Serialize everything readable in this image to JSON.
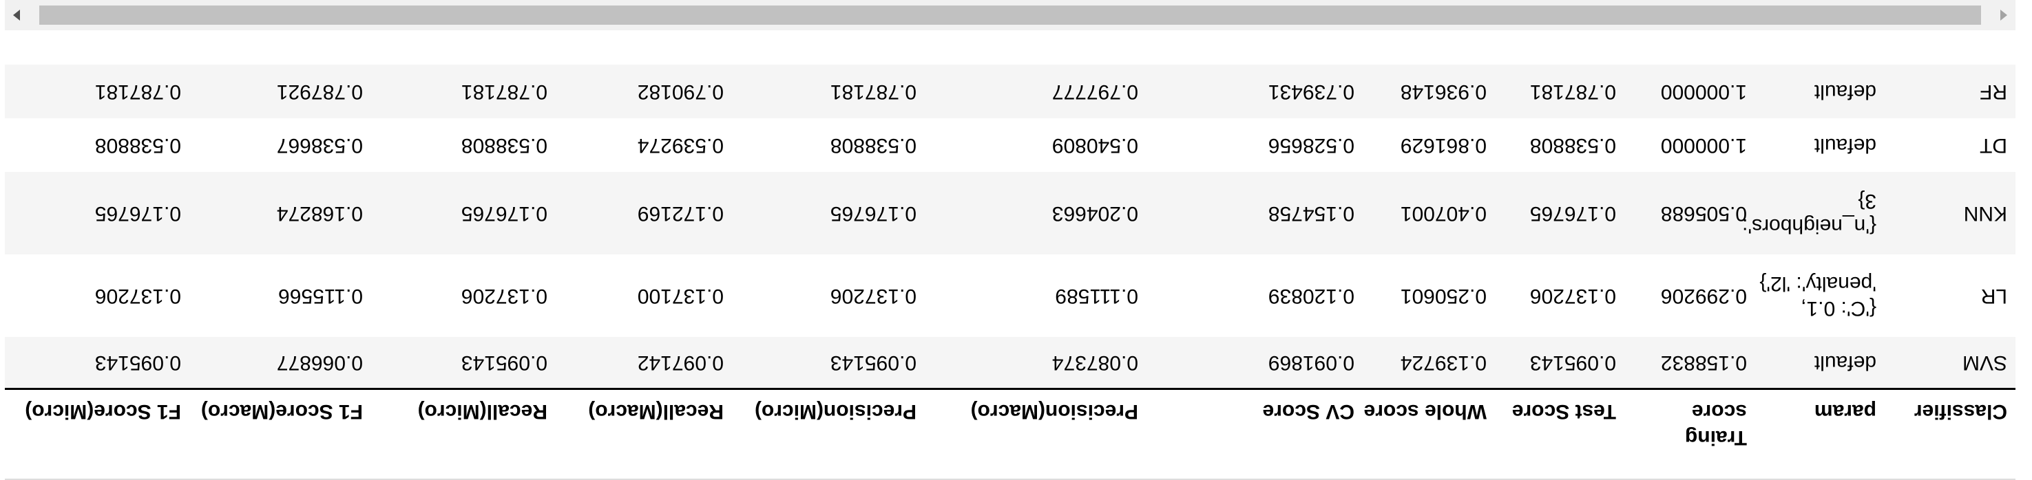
{
  "table": {
    "headers": [
      "Classifier",
      "param",
      "Traing score",
      "Test Score",
      "Whole score",
      "CV Score",
      "Precision(Macro)",
      "Precision(Micro)",
      "Recall(Macro)",
      "Recall(Micro)",
      "F1 Score(Macro)",
      "F1 Score(Micro)"
    ],
    "rows": [
      [
        "SVM",
        "default",
        "0.158832",
        "0.095143",
        "0.139724",
        "0.091869",
        "0.087374",
        "0.095143",
        "0.097142",
        "0.095143",
        "0.066877",
        "0.095143"
      ],
      [
        "LR",
        "{'C': 0.1, 'penalty': 'l2'}",
        "0.299206",
        "0.137206",
        "0.250601",
        "0.120839",
        "0.111589",
        "0.137206",
        "0.137100",
        "0.137206",
        "0.115566",
        "0.137206"
      ],
      [
        "KNN",
        "{'n_neighbors': 3}",
        "0.505688",
        "0.176765",
        "0.407001",
        "0.154758",
        "0.204663",
        "0.176765",
        "0.172169",
        "0.176765",
        "0.168274",
        "0.176765"
      ],
      [
        "DT",
        "default",
        "1.000000",
        "0.538808",
        "0.861629",
        "0.528656",
        "0.540809",
        "0.538808",
        "0.539274",
        "0.538808",
        "0.538667",
        "0.538808"
      ],
      [
        "RF",
        "default",
        "1.000000",
        "0.787181",
        "0.936148",
        "0.739431",
        "0.797777",
        "0.787181",
        "0.790182",
        "0.787181",
        "0.787921",
        "0.787181"
      ]
    ]
  },
  "scrollbar": {
    "left_arrow": "scroll-left-arrow-icon",
    "right_arrow": "scroll-right-arrow-icon"
  }
}
